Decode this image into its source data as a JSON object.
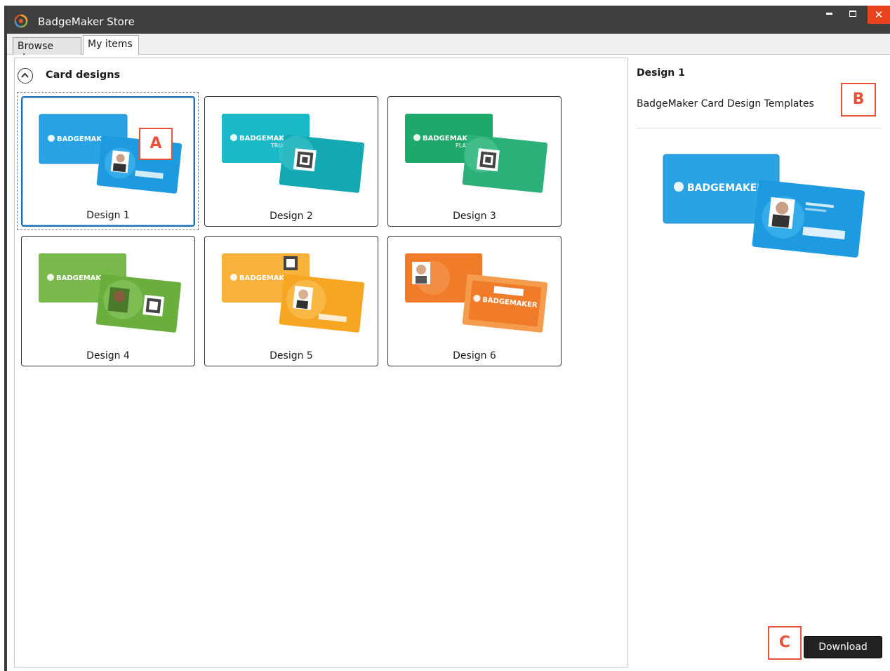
{
  "window": {
    "title": "BadgeMaker Store",
    "close_glyph": "✕"
  },
  "tabs": [
    {
      "label": "Browse store",
      "active": false
    },
    {
      "label": "My items",
      "active": true
    }
  ],
  "section": {
    "title": "Card designs",
    "collapse_icon": "chevron-up-circle-icon"
  },
  "designs": [
    {
      "label": "Design 1",
      "color": "#1e9be0",
      "selected": true
    },
    {
      "label": "Design 2",
      "color": "#14a8b2",
      "selected": false
    },
    {
      "label": "Design 3",
      "color": "#2bb07a",
      "selected": false
    },
    {
      "label": "Design 4",
      "color": "#6aaf3d",
      "selected": false
    },
    {
      "label": "Design 5",
      "color": "#f6a623",
      "selected": false
    },
    {
      "label": "Design 6",
      "color": "#f07c2a",
      "selected": false
    }
  ],
  "card_text": {
    "brand": "BADGEMAKER",
    "trial": "TRIAL",
    "play": "PLAY"
  },
  "detail": {
    "title": "Design 1",
    "description": "BadgeMaker Card Design Templates"
  },
  "actions": {
    "download_label": "Download"
  },
  "callouts": {
    "a": "A",
    "b": "B",
    "c": "C"
  },
  "colors": {
    "titlebar": "#3f3f3f",
    "close": "#e8431c",
    "selection": "#1c6fb5",
    "callout": "#e8503a"
  }
}
